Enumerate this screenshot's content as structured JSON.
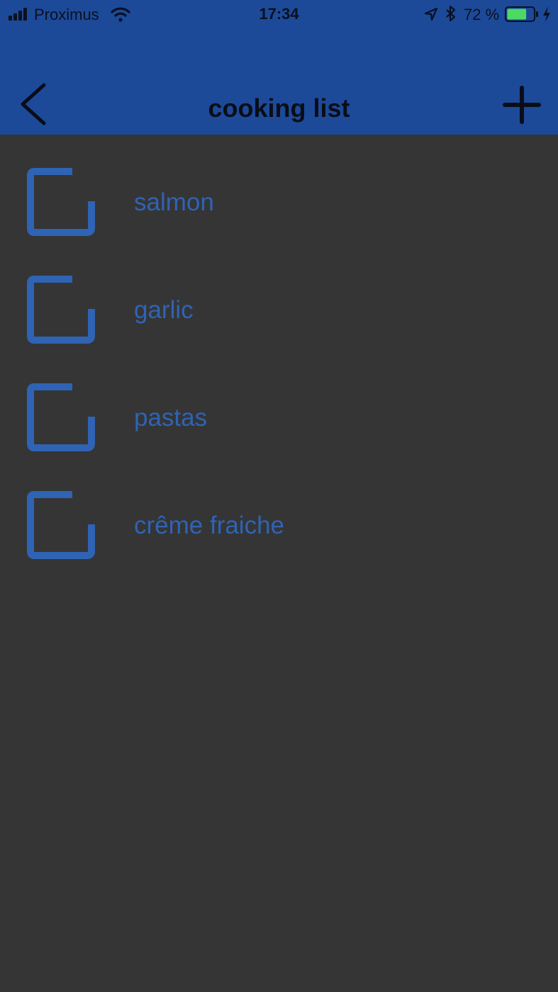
{
  "status_bar": {
    "carrier": "Proximus",
    "time": "17:34",
    "battery_percent": "72 %",
    "battery_level": 0.72,
    "icons": [
      "signal-icon",
      "wifi-icon",
      "location-arrow-icon",
      "bluetooth-icon",
      "battery-icon",
      "charging-bolt-icon"
    ]
  },
  "nav": {
    "title": "cooking list",
    "back_icon": "chevron-left-icon",
    "add_icon": "plus-icon"
  },
  "list": {
    "items": [
      {
        "label": "salmon",
        "checked": false
      },
      {
        "label": "garlic",
        "checked": false
      },
      {
        "label": "pastas",
        "checked": false
      },
      {
        "label": "crême fraiche",
        "checked": false
      }
    ]
  },
  "colors": {
    "header_bg": "#1c4a99",
    "body_bg": "#353535",
    "accent": "#2f63b4",
    "battery_fill": "#4cd964"
  }
}
